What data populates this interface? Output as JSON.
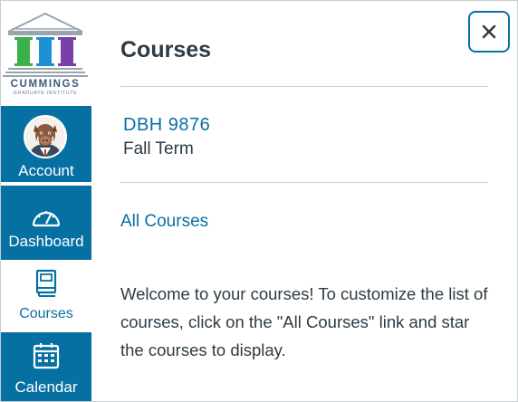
{
  "brand": {
    "name": "CUMMINGS",
    "subtitle": "GRADUATE INSTITUTE",
    "colors": {
      "pillar_1": "#3db04b",
      "pillar_2": "#1f8fd4",
      "pillar_3": "#7a3fa8",
      "roof": "#9aa4ae"
    }
  },
  "sidebar": {
    "accent": "#0770a3",
    "items": [
      {
        "label": "Account",
        "icon": "avatar"
      },
      {
        "label": "Dashboard",
        "icon": "dashboard-gauge-icon"
      },
      {
        "label": "Courses",
        "icon": "courses-book-icon",
        "active": true
      },
      {
        "label": "Calendar",
        "icon": "calendar-icon"
      }
    ]
  },
  "tray": {
    "title": "Courses",
    "close_icon": "close-icon",
    "course": {
      "code": "DBH 9876",
      "term": "Fall Term"
    },
    "all_courses_link": "All Courses",
    "welcome_text": "Welcome to your courses! To customize the list of courses, click on the \"All Courses\" link and star the courses to display."
  }
}
